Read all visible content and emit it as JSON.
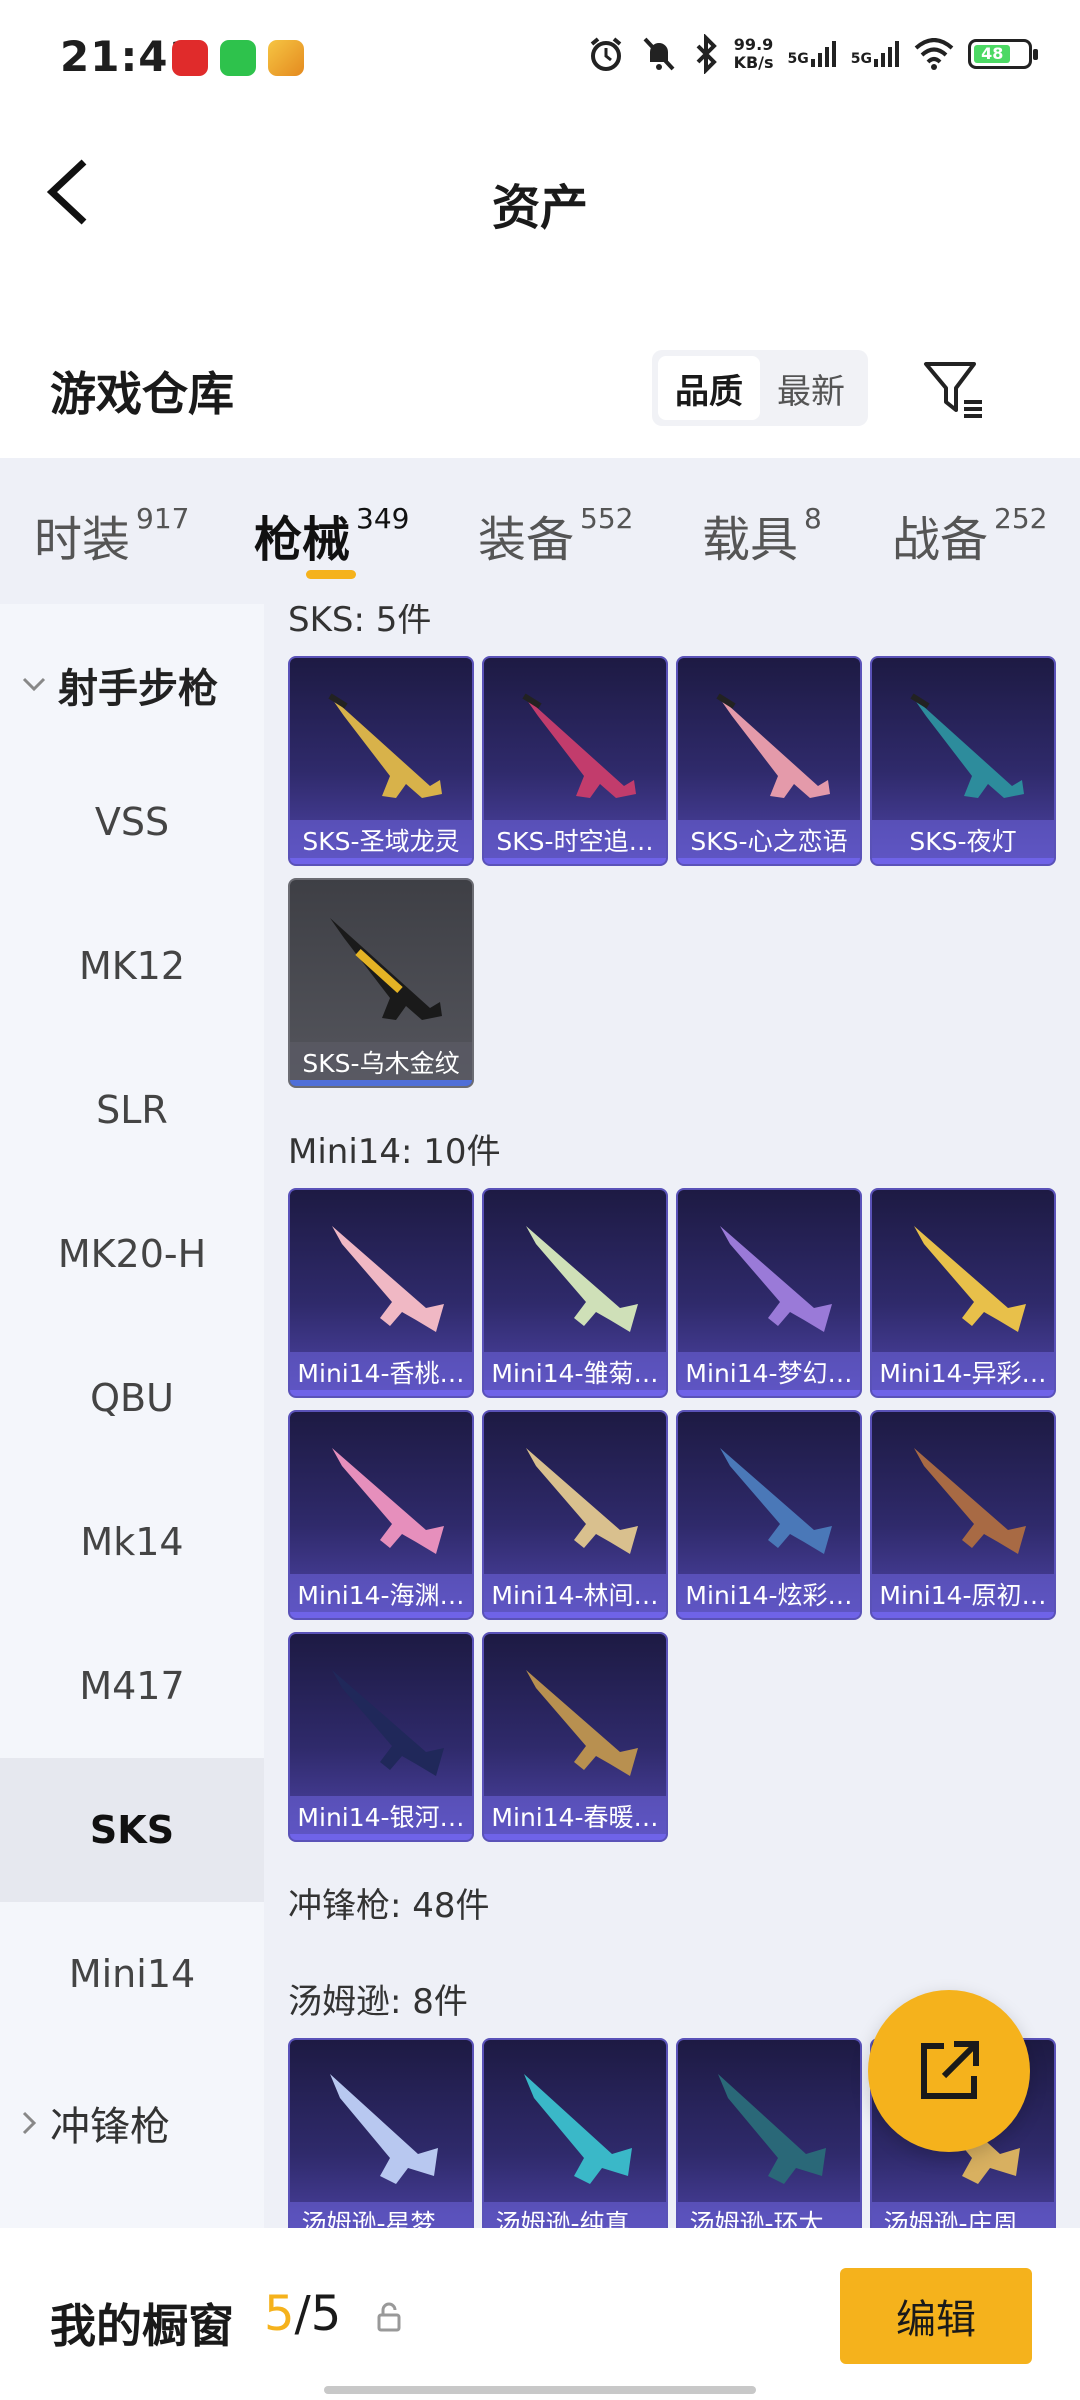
{
  "status_bar": {
    "time": "21:41",
    "net_speed_value": "99.9",
    "net_speed_unit": "KB/s",
    "signal1": "5G",
    "signal2": "5G",
    "battery": "48"
  },
  "header": {
    "title": "资产"
  },
  "warehouse": {
    "title": "游戏仓库",
    "sort_options": [
      "品质",
      "最新"
    ],
    "active_sort": "品质"
  },
  "tabs": [
    {
      "label": "时装",
      "count": "917"
    },
    {
      "label": "枪械",
      "count": "349"
    },
    {
      "label": "装备",
      "count": "552"
    },
    {
      "label": "载具",
      "count": "8"
    },
    {
      "label": "战备",
      "count": "252"
    }
  ],
  "active_tab": "枪械",
  "sidebar": {
    "group_open": "射手步枪",
    "items": [
      "VSS",
      "MK12",
      "SLR",
      "MK20-H",
      "QBU",
      "Mk14",
      "M417",
      "SKS",
      "Mini14"
    ],
    "active_item": "SKS",
    "group_collapsed": "冲锋枪"
  },
  "content": {
    "sections": [
      {
        "title": "SKS: 5件",
        "cards": [
          "SKS-圣域龙灵",
          "SKS-时空追…",
          "SKS-心之恋语",
          "SKS-夜灯",
          "SKS-乌木金纹"
        ]
      },
      {
        "title": "Mini14: 10件",
        "cards": [
          "Mini14-香桃…",
          "Mini14-雏菊…",
          "Mini14-梦幻…",
          "Mini14-异彩…",
          "Mini14-海渊…",
          "Mini14-林间…",
          "Mini14-炫彩…",
          "Mini14-原初…",
          "Mini14-银河…",
          "Mini14-春暖…"
        ]
      },
      {
        "title": "冲锋枪: 48件",
        "cards": []
      },
      {
        "title": "汤姆逊: 8件",
        "cards": [
          "汤姆逊-星梦…",
          "汤姆逊-纯真…",
          "汤姆逊-环太…",
          "汤姆逊-庄周…"
        ]
      }
    ]
  },
  "bottom_bar": {
    "showcase_label": "我的橱窗",
    "showcase_current": "5",
    "showcase_sep": "/",
    "showcase_total": "5",
    "edit_label": "编辑"
  },
  "colors": {
    "accent": "#f5b21c",
    "card_purple": "#2f2a6b",
    "card_grey": "#55565d",
    "tab_bg": "#eef0f7"
  },
  "icons": [
    "back-arrow-icon",
    "filter-icon",
    "share-export-icon",
    "lock-icon",
    "chevron-down-icon",
    "chevron-right-icon"
  ]
}
